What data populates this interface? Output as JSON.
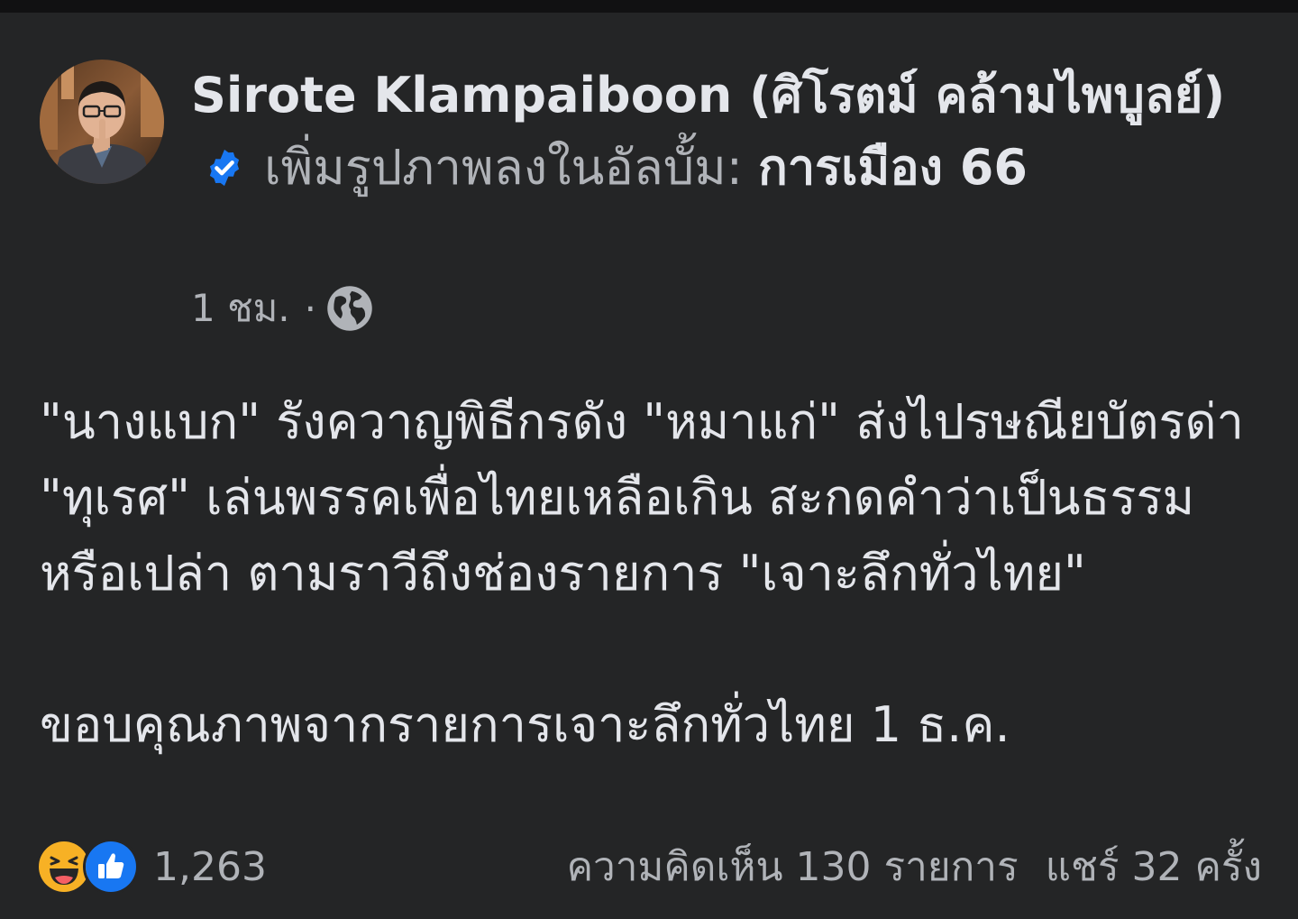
{
  "post": {
    "author": "Sirote Klampaiboon (ศิโรตม์ คล้ามไพบูลย์)",
    "action": "เพิ่มรูปภาพลงในอัลบั้ม:",
    "album": "การเมือง 66",
    "timestamp": "1 ชม.",
    "separator": "·",
    "privacy_icon": "globe-icon",
    "verified_icon": "verified-badge-icon",
    "body_paragraph_1": "\"นางแบก\" รังควาญพิธีกรดัง \"หมาแก่\" ส่งไปรษณียบัตรด่า \"ทุเรศ\" เล่นพรรคเพื่อไทยเหลือเกิน สะกดคำว่าเป็นธรรมหรือเปล่า ตามราวีถึงช่องรายการ \"เจาะลึกทั่วไทย\"",
    "body_paragraph_2": "ขอบคุณภาพจากรายการเจาะลึกทั่วไทย 1 ธ.ค."
  },
  "footer": {
    "reaction_icons": [
      "haha-icon",
      "like-icon"
    ],
    "reaction_count": "1,263",
    "comments": "ความคิดเห็น 130 รายการ",
    "shares": "แชร์ 32 ครั้ง"
  },
  "colors": {
    "background": "#242526",
    "primary_text": "#e4e6eb",
    "secondary_text": "#b0b3b8",
    "verified_blue": "#1877f2",
    "like_blue": "#1877f2",
    "haha_yellow": "#f7b125"
  }
}
